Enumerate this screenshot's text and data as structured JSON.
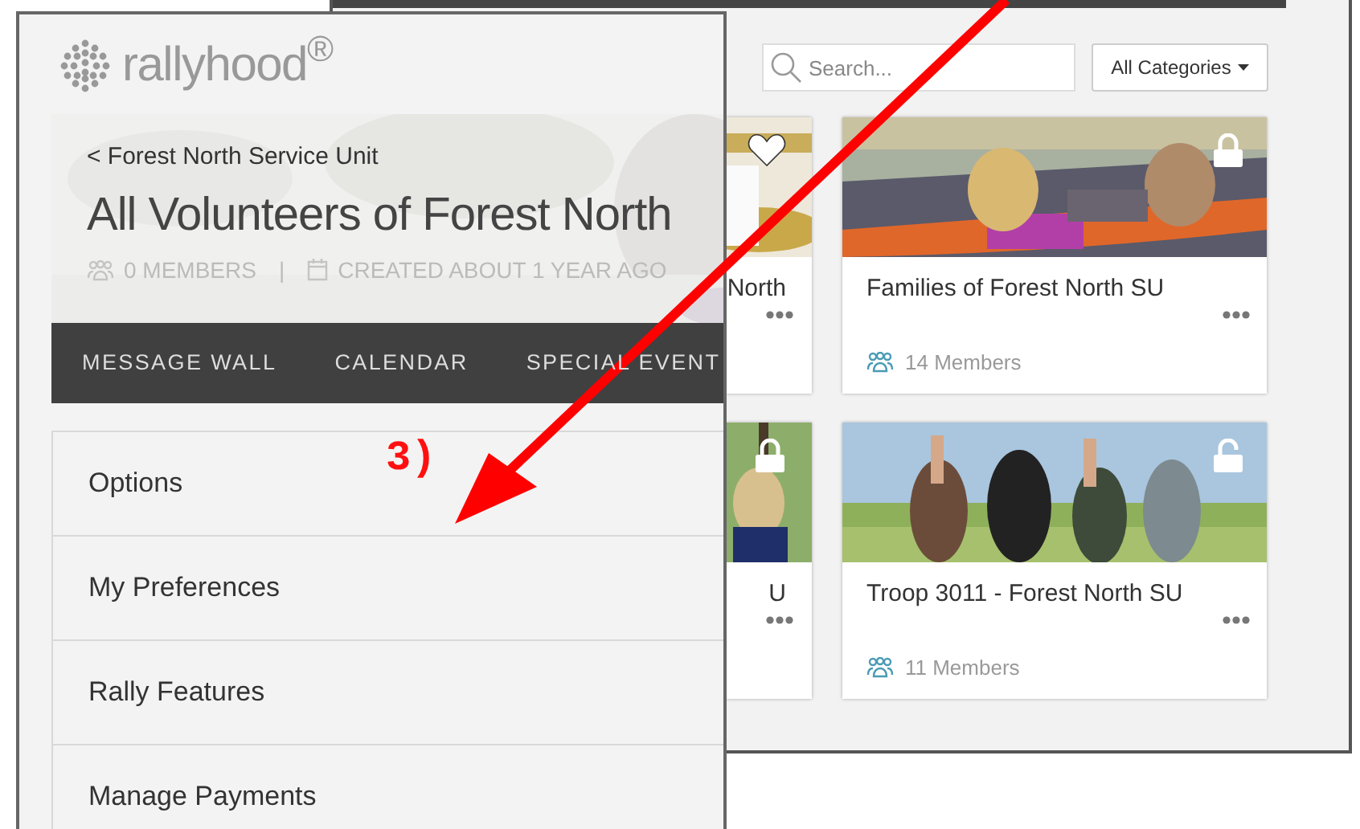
{
  "back_window": {
    "search": {
      "placeholder": "Search..."
    },
    "category_button": {
      "label": "All Categories"
    },
    "cards": [
      {
        "kind": "partial",
        "title": "North",
        "favorite": true
      },
      {
        "kind": "full",
        "title": "Families of Forest North SU",
        "members": "14 Members",
        "locked": true
      },
      {
        "kind": "partial",
        "title": "U",
        "locked": true
      },
      {
        "kind": "full",
        "title": "Troop 3011 - Forest North SU",
        "members": "11 Members",
        "locked": false
      }
    ]
  },
  "front_window": {
    "logo": "rallyhood$^{®}$",
    "back_link": "< Forest North Service Unit",
    "group_title": "All Volunteers of Forest North",
    "members": "0 MEMBERS",
    "separator": "|",
    "created": "CREATED ABOUT 1 YEAR AGO",
    "tabs": [
      {
        "label": "MESSAGE WALL"
      },
      {
        "label": "CALENDAR"
      },
      {
        "label": "SPECIAL EVENT"
      }
    ],
    "menu": [
      {
        "label": "Options"
      },
      {
        "label": "My Preferences"
      },
      {
        "label": "Rally Features"
      },
      {
        "label": "Manage Payments"
      }
    ]
  },
  "annotation": {
    "label": "3)"
  }
}
